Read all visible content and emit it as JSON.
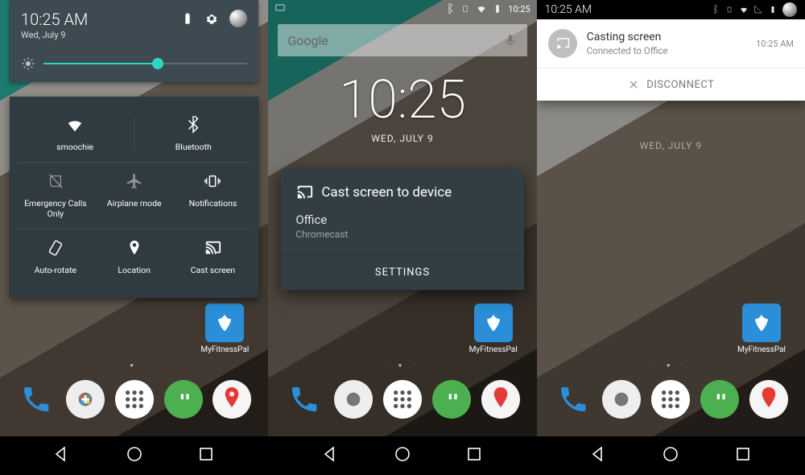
{
  "status": {
    "time": "10:25",
    "date_short": "Wed, July 9",
    "date_upper": "WED, JULY 9"
  },
  "pane1": {
    "qs_time": "10:25 AM",
    "qs_date": "Wed, July 9",
    "tiles": {
      "wifi": "smoochie",
      "bluetooth": "Bluetooth",
      "emergency": "Emergency Calls Only",
      "airplane": "Airplane mode",
      "notifications": "Notifications",
      "rotate": "Auto-rotate",
      "location": "Location",
      "cast": "Cast screen"
    }
  },
  "pane2": {
    "search_placeholder": "Google",
    "dialog": {
      "title": "Cast screen to device",
      "device_name": "Office",
      "device_type": "Chromecast",
      "settings_label": "SETTINGS"
    }
  },
  "pane3": {
    "shade_time": "10:25 AM",
    "notif": {
      "title": "Casting screen",
      "subtitle": "Connected to Office",
      "time": "10:25 AM",
      "action": "DISCONNECT"
    }
  },
  "apps": {
    "myfitnesspal": "MyFitnessPal"
  }
}
